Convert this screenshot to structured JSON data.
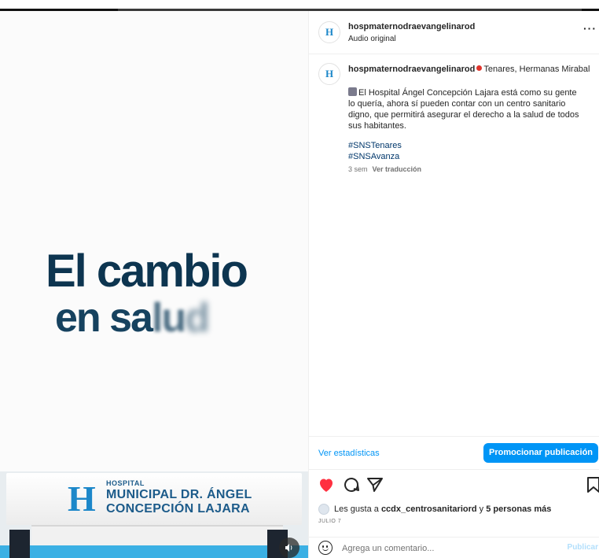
{
  "video": {
    "headline_line1": "El cambio",
    "headline_line2a": "en sa",
    "headline_line2b": "lu",
    "headline_line2c": "d",
    "sign_small": "HOSPITAL",
    "sign_line1": "MUNICIPAL DR. ÁNGEL",
    "sign_line2": "CONCEPCIÓN LAJARA",
    "logo_letter": "H",
    "mute_icon": "speaker-icon"
  },
  "header": {
    "username": "hospmaternodraevangelinarod",
    "audio": "Audio original",
    "avatar_letter": "H",
    "more_label": "···"
  },
  "caption": {
    "username": "hospmaternodraevangelinarod",
    "location": "Tenares, Hermanas Mirabal",
    "body": "El Hospital Ángel Concepción Lajara está como su gente lo quería, ahora sí pueden contar con un centro sanitario digno, que permitirá asegurar el derecho a la salud de todos sus habitantes.",
    "hashtags": [
      "#SNSTenares",
      "#SNSAvanza"
    ],
    "time": "3 sem",
    "translate": "Ver traducción"
  },
  "actions": {
    "stats_label": "Ver estadísticas",
    "promote_label": "Promocionar publicación"
  },
  "likes": {
    "prefix": "Les gusta a ",
    "user": "ccdx_centrosanitariord",
    "middle": " y ",
    "others": "5 personas más",
    "date": "JULIO 7"
  },
  "comment": {
    "placeholder": "Agrega un comentario...",
    "publish_label": "Publicar"
  },
  "colors": {
    "accent": "#0095f6",
    "heart": "#ff3040",
    "headline": "#0d3550"
  }
}
